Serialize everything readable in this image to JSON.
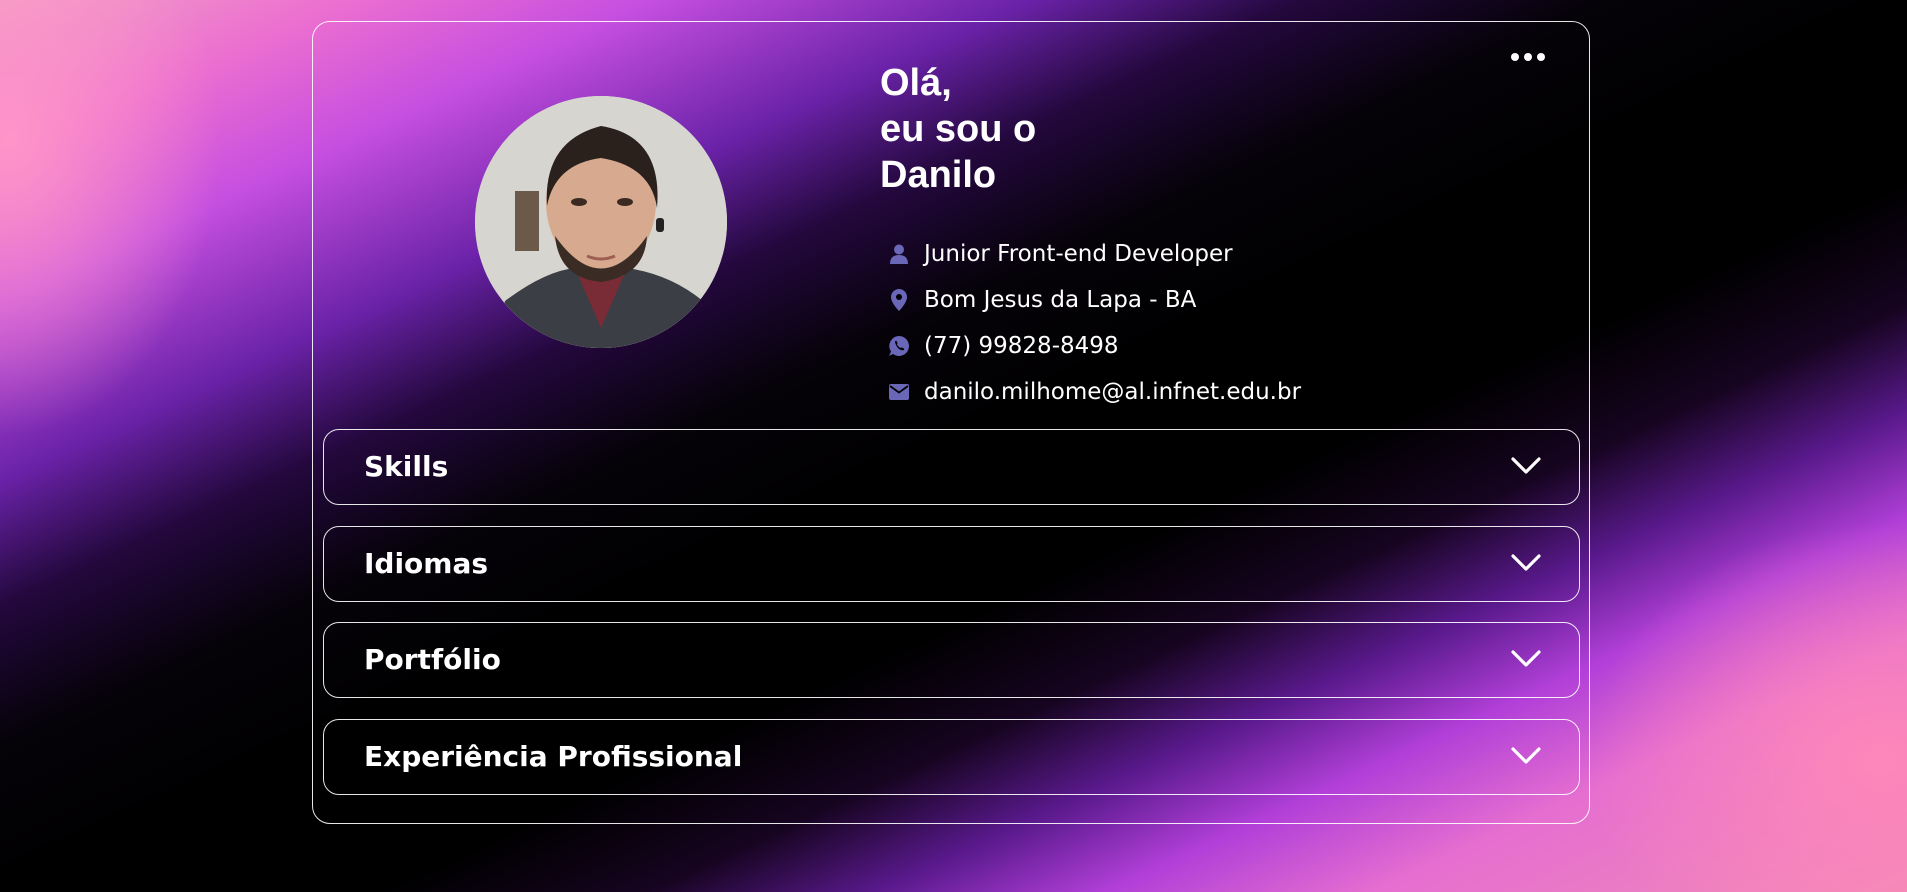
{
  "header": {
    "greeting_lines": [
      "Olá,",
      "eu sou o",
      "Danilo"
    ]
  },
  "profile": {
    "avatar": "profile-photo",
    "info": [
      {
        "icon": "user-icon",
        "text": "Junior Front-end Developer"
      },
      {
        "icon": "location-pin-icon",
        "text": "Bom Jesus da Lapa - BA"
      },
      {
        "icon": "whatsapp-icon",
        "text": "(77) 99828-8498"
      },
      {
        "icon": "mail-icon",
        "text": "danilo.milhome@al.infnet.edu.br"
      }
    ]
  },
  "sections": [
    {
      "label": "Skills",
      "icon": "chevron-down-icon"
    },
    {
      "label": "Idiomas",
      "icon": "chevron-down-icon"
    },
    {
      "label": "Portfólio",
      "icon": "chevron-down-icon"
    },
    {
      "label": "Experiência Profissional",
      "icon": "chevron-down-icon"
    }
  ],
  "colors": {
    "icon_accent": "#6a66b8",
    "card_border": "#ffffff",
    "text": "#ffffff"
  }
}
